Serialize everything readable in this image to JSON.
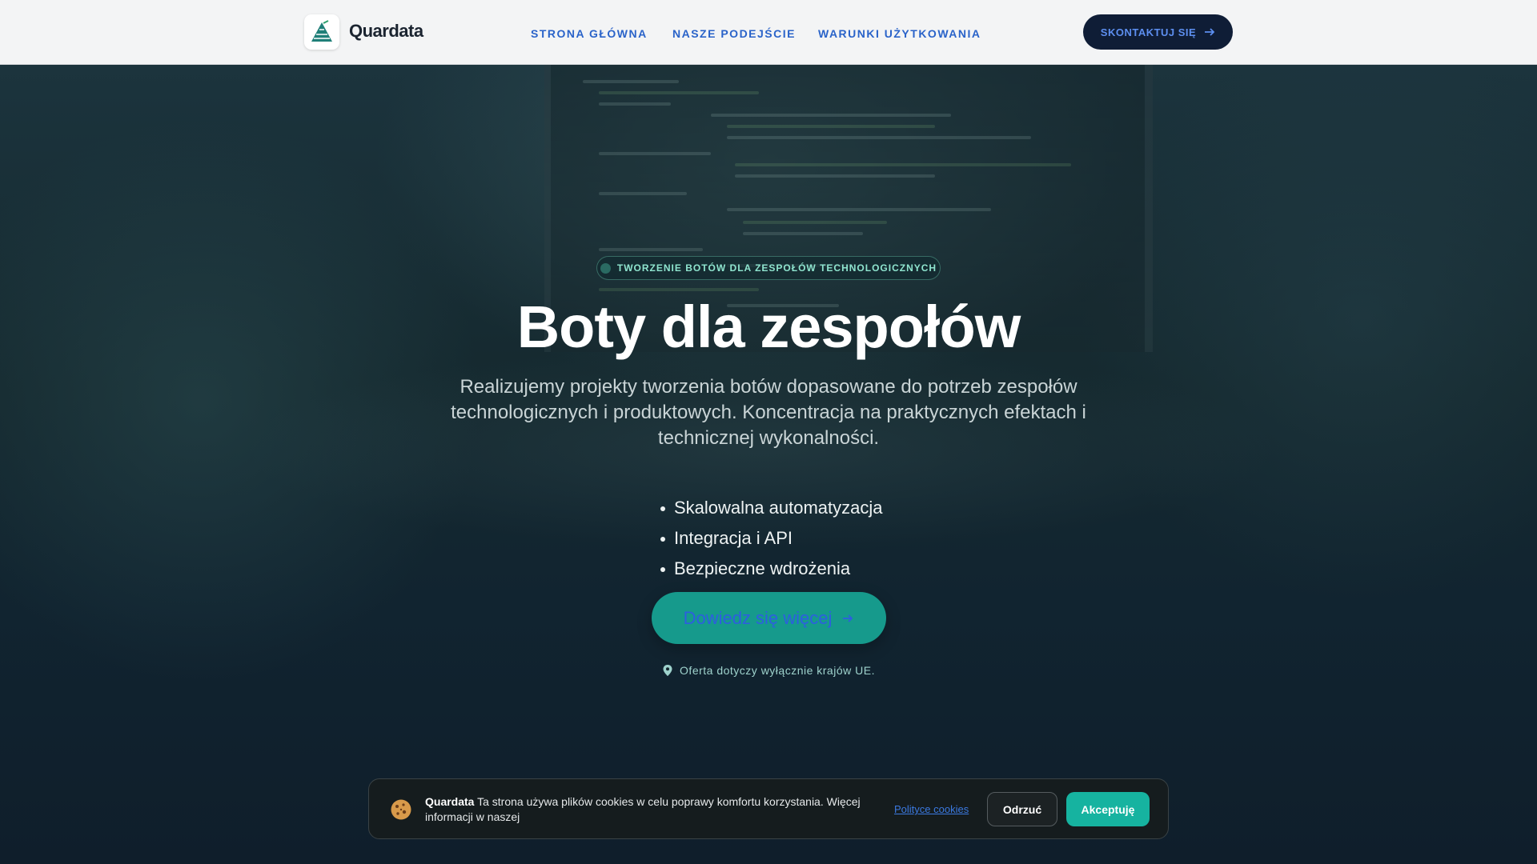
{
  "header": {
    "brand": "Quardata",
    "nav": [
      "STRONA GŁÓWNA",
      "NASZE PODEJŚCIE",
      "WARUNKI UŻYTKOWANIA"
    ],
    "contact_label": "SKONTAKTUJ SIĘ"
  },
  "hero": {
    "badge": "TWORZENIE BOTÓW DLA ZESPOŁÓW TECHNOLOGICZNYCH",
    "title": "Boty dla zespołów",
    "subtitle": "Realizujemy projekty tworzenia botów dopasowane do potrzeb zespołów technologicznych i produktowych. Koncentracja na praktycznych efektach i technicznej wykonalności.",
    "features": [
      "Skalowalna automatyzacja",
      "Integracja i API",
      "Bezpieczne wdrożenia"
    ],
    "cta_label": "Dowiedz się więcej",
    "eu_note": "Oferta dotyczy wyłącznie krajów UE."
  },
  "cookie": {
    "brand": "Quardata",
    "text": "Ta strona używa plików cookies w celu poprawy komfortu korzystania. Więcej informacji w naszej",
    "policy_link": "Polityce cookies",
    "reject_label": "Odrzuć",
    "accept_label": "Akceptuję"
  },
  "colors": {
    "accent_teal": "#169a8c",
    "nav_blue": "#2a63c9",
    "dark_navy": "#0f1d36"
  }
}
